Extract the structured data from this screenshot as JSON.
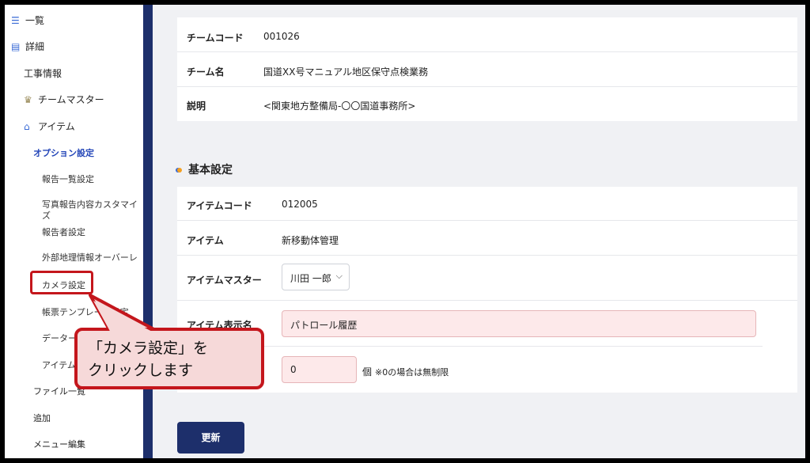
{
  "sidebar": {
    "items": [
      {
        "label": "一覧",
        "icon": "list-icon"
      },
      {
        "label": "詳細",
        "icon": "document-icon"
      },
      {
        "label": "工事情報"
      },
      {
        "label": "チームマスター",
        "icon": "crown-icon"
      },
      {
        "label": "アイテム",
        "icon": "store-icon"
      },
      {
        "label": "オプション設定",
        "active": true
      },
      {
        "label": "報告一覧設定"
      },
      {
        "label": "写真報告内容カスタマイズ"
      },
      {
        "label": "報告者設定"
      },
      {
        "label": "外部地理情報オーバーレイ"
      },
      {
        "label": "カメラ設定",
        "highlighted": true
      },
      {
        "label": "帳票テンプレート設定"
      },
      {
        "label": "データー"
      },
      {
        "label": "アイテム"
      },
      {
        "label": "ファイル一覧"
      },
      {
        "label": "追加"
      },
      {
        "label": "メニュー編集"
      }
    ]
  },
  "team": {
    "code_label": "チームコード",
    "code_value": "001026",
    "name_label": "チーム名",
    "name_value": "国道XX号マニュアル地区保守点検業務",
    "desc_label": "説明",
    "desc_value": "<関東地方整備局-〇〇国道事務所>"
  },
  "basic": {
    "section_title": "基本設定",
    "item_code_label": "アイテムコード",
    "item_code_value": "012005",
    "item_label": "アイテム",
    "item_value": "新移動体管理",
    "item_master_label": "アイテムマスター",
    "item_master_value": "川田 一郎",
    "display_name_label": "アイテム表示名",
    "display_name_value": "パトロール履歴",
    "limit_value": "0",
    "limit_unit": "個",
    "limit_note": "※0の場合は無制限"
  },
  "actions": {
    "update_label": "更新"
  },
  "callout": {
    "line1": "「カメラ設定」を",
    "line2": "クリックします"
  },
  "colors": {
    "sidebar_accent": "#1d2f6b",
    "active_link": "#2446b8",
    "highlight_red": "#c4161c",
    "callout_fill": "#f6d9d9",
    "input_pink": "#fde9ea"
  }
}
